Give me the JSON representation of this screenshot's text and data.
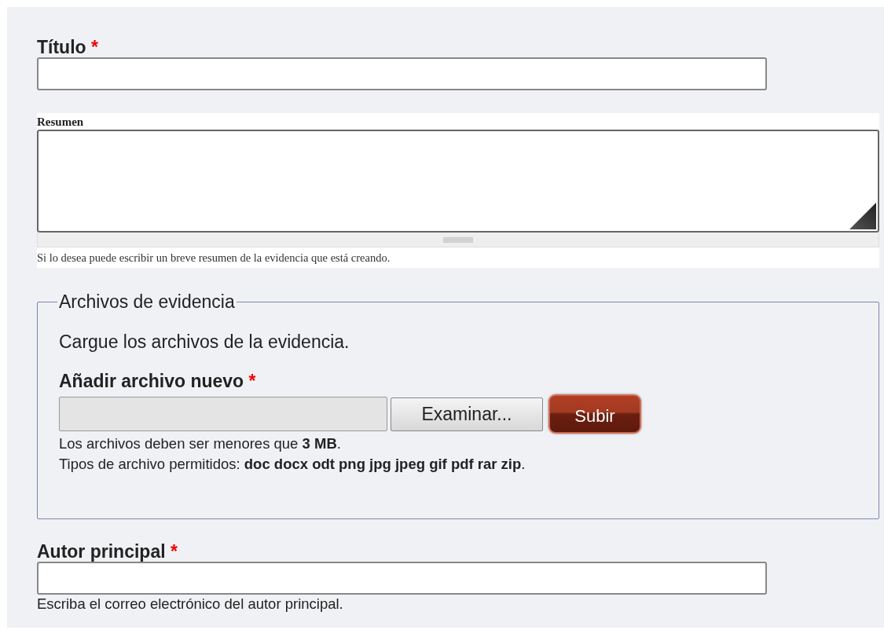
{
  "title_field": {
    "label": "Título",
    "required_mark": "*"
  },
  "summary_field": {
    "label": "Resumen",
    "description": "Si lo desea puede escribir un breve resumen de la evidencia que está creando."
  },
  "files_fieldset": {
    "legend": "Archivos de evidencia",
    "intro": "Cargue los archivos de la evidencia.",
    "upload": {
      "label": "Añadir archivo nuevo",
      "required_mark": "*",
      "browse_button": "Examinar...",
      "upload_button": "Subir"
    },
    "help_lines": [
      "Los archivos deben ser menores que **3 MB**.",
      "Tipos de archivo permitidos: **doc docx odt png jpg jpeg gif pdf rar zip**."
    ]
  },
  "author_field": {
    "label": "Autor principal",
    "required_mark": "*",
    "description": "Escriba el correo electrónico del autor principal."
  }
}
